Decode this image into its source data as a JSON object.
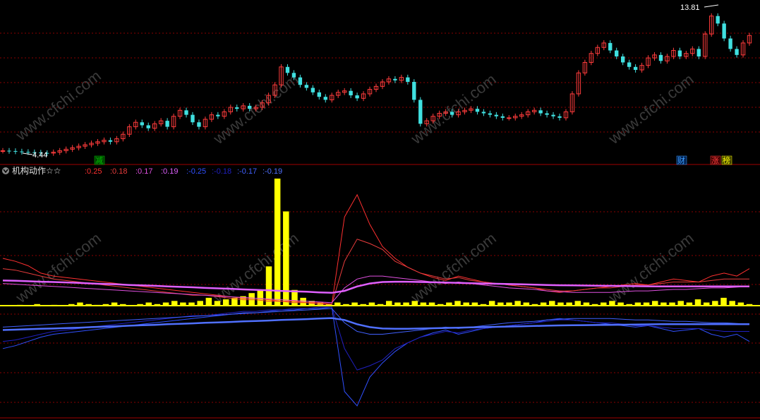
{
  "indicator": {
    "name": "机构动作☆☆",
    "values": [
      {
        "text": ":0.25",
        "color": "#ff3030"
      },
      {
        "text": ":0.18",
        "color": "#e83c3c"
      },
      {
        "text": ":0.17",
        "color": "#e050e0"
      },
      {
        "text": ":0.19",
        "color": "#e060ff"
      },
      {
        "text": ":-0.25",
        "color": "#3050ff"
      },
      {
        "text": ":-0.18",
        "color": "#2020c0"
      },
      {
        "text": ":-0.17",
        "color": "#4060ff"
      },
      {
        "text": ":-0.19",
        "color": "#5070ff"
      }
    ]
  },
  "price": {
    "high_label": "13.81",
    "low_label": "4.44",
    "markers": [
      {
        "text": "减",
        "color": "#00c000",
        "bg": "#004000"
      },
      {
        "text": "财",
        "color": "#40a0ff",
        "bg": "#002050"
      },
      {
        "text": "涨",
        "color": "#ff4040",
        "bg": "#400000"
      },
      {
        "text": "榜",
        "color": "#ffff00",
        "bg": "#404000"
      }
    ]
  },
  "watermark": "www.cfchi.com",
  "colors": {
    "up": "#ff3c3c",
    "down": "#40e0e0",
    "yellow": "#ffff00",
    "magenta": "#e050e0",
    "blue": "#3040ff",
    "grid": "#8a0000"
  },
  "chart_data": [
    {
      "type": "candlestick",
      "description_axis": "price",
      "ylim": [
        4.2,
        14.2
      ],
      "close": [
        4.6,
        4.58,
        4.55,
        4.52,
        4.5,
        4.48,
        4.45,
        4.44,
        4.5,
        4.6,
        4.7,
        4.8,
        4.9,
        5.0,
        5.1,
        5.2,
        5.3,
        5.2,
        5.4,
        5.7,
        6.2,
        6.5,
        6.3,
        6.1,
        6.4,
        6.6,
        6.2,
        6.9,
        7.3,
        7.0,
        6.5,
        6.2,
        6.7,
        7.0,
        6.9,
        7.2,
        7.5,
        7.4,
        7.6,
        7.4,
        7.5,
        7.8,
        8.3,
        9.0,
        10.2,
        9.8,
        9.5,
        9.0,
        8.8,
        8.5,
        8.2,
        8.0,
        8.3,
        8.5,
        8.6,
        8.3,
        8.1,
        8.4,
        8.7,
        8.9,
        9.2,
        9.4,
        9.3,
        9.5,
        9.2,
        8.0,
        6.4,
        6.6,
        6.9,
        7.1,
        7.2,
        7.0,
        7.2,
        7.3,
        7.4,
        7.2,
        7.1,
        7.0,
        6.9,
        6.8,
        6.8,
        6.9,
        7.0,
        7.2,
        7.3,
        7.1,
        7.0,
        6.9,
        6.8,
        7.2,
        8.4,
        9.8,
        10.5,
        11.1,
        11.5,
        11.8,
        11.3,
        10.9,
        10.5,
        10.2,
        10.0,
        10.3,
        10.8,
        11.0,
        10.6,
        10.9,
        11.3,
        10.9,
        11.1,
        11.4,
        10.9,
        12.4,
        13.6,
        13.1,
        12.1,
        11.4,
        11.0,
        11.8,
        12.3
      ],
      "last_price": 13.81,
      "low_price": 4.44
    },
    {
      "type": "line",
      "description_axis": "indicator",
      "ylim": [
        -0.75,
        0.85
      ],
      "series": [
        {
          "color": "#ff3030",
          "values": [
            0.32,
            0.3,
            0.27,
            0.22,
            0.2,
            0.19,
            0.18,
            0.17,
            0.16,
            0.15,
            0.14,
            0.13,
            0.12,
            0.11,
            0.1,
            0.09,
            0.08,
            0.07,
            0.06,
            0.05,
            0.05,
            0.04,
            0.03,
            0.03,
            0.02,
            0.02,
            0.01,
            0.6,
            0.75,
            0.55,
            0.4,
            0.32,
            0.26,
            0.22,
            0.19,
            0.17,
            0.2,
            0.18,
            0.16,
            0.15,
            0.14,
            0.13,
            0.12,
            0.1,
            0.09,
            0.1,
            0.11,
            0.12,
            0.13,
            0.14,
            0.15,
            0.14,
            0.16,
            0.18,
            0.17,
            0.16,
            0.2,
            0.22,
            0.2,
            0.25
          ]
        },
        {
          "color": "#e83c3c",
          "values": [
            0.25,
            0.24,
            0.22,
            0.2,
            0.18,
            0.17,
            0.16,
            0.15,
            0.14,
            0.13,
            0.12,
            0.11,
            0.1,
            0.09,
            0.08,
            0.07,
            0.07,
            0.06,
            0.05,
            0.04,
            0.04,
            0.03,
            0.03,
            0.02,
            0.02,
            0.01,
            0.01,
            0.3,
            0.45,
            0.42,
            0.38,
            0.3,
            0.26,
            0.22,
            0.2,
            0.18,
            0.19,
            0.17,
            0.16,
            0.15,
            0.14,
            0.13,
            0.12,
            0.11,
            0.1,
            0.1,
            0.11,
            0.12,
            0.12,
            0.13,
            0.14,
            0.14,
            0.15,
            0.16,
            0.16,
            0.16,
            0.17,
            0.18,
            0.18,
            0.18
          ]
        },
        {
          "color": "#e050e0",
          "values": [
            0.15,
            0.145,
            0.14,
            0.135,
            0.13,
            0.125,
            0.12,
            0.115,
            0.11,
            0.105,
            0.1,
            0.095,
            0.09,
            0.085,
            0.08,
            0.075,
            0.07,
            0.065,
            0.06,
            0.055,
            0.05,
            0.045,
            0.04,
            0.035,
            0.03,
            0.025,
            0.02,
            0.12,
            0.18,
            0.2,
            0.2,
            0.19,
            0.18,
            0.17,
            0.16,
            0.15,
            0.16,
            0.15,
            0.14,
            0.13,
            0.12,
            0.115,
            0.11,
            0.1,
            0.095,
            0.09,
            0.09,
            0.09,
            0.09,
            0.095,
            0.1,
            0.1,
            0.105,
            0.11,
            0.11,
            0.115,
            0.12,
            0.12,
            0.125,
            0.13
          ]
        },
        {
          "color": "#e060ff",
          "values": [
            0.17,
            0.168,
            0.165,
            0.162,
            0.16,
            0.157,
            0.154,
            0.15,
            0.147,
            0.144,
            0.14,
            0.137,
            0.134,
            0.13,
            0.127,
            0.124,
            0.12,
            0.117,
            0.114,
            0.11,
            0.107,
            0.104,
            0.1,
            0.097,
            0.094,
            0.09,
            0.087,
            0.1,
            0.13,
            0.15,
            0.16,
            0.162,
            0.162,
            0.16,
            0.158,
            0.156,
            0.154,
            0.152,
            0.15,
            0.148,
            0.146,
            0.144,
            0.142,
            0.14,
            0.138,
            0.137,
            0.136,
            0.135,
            0.134,
            0.133,
            0.132,
            0.131,
            0.13,
            0.13,
            0.13,
            0.13,
            0.13,
            0.13,
            0.13,
            0.13
          ]
        },
        {
          "color": "#3050ff",
          "values": [
            -0.3,
            -0.28,
            -0.25,
            -0.22,
            -0.2,
            -0.19,
            -0.18,
            -0.17,
            -0.16,
            -0.15,
            -0.14,
            -0.13,
            -0.12,
            -0.11,
            -0.1,
            -0.09,
            -0.08,
            -0.07,
            -0.06,
            -0.05,
            -0.05,
            -0.04,
            -0.03,
            -0.03,
            -0.02,
            -0.02,
            -0.01,
            -0.6,
            -0.7,
            -0.5,
            -0.4,
            -0.32,
            -0.26,
            -0.22,
            -0.19,
            -0.17,
            -0.2,
            -0.18,
            -0.16,
            -0.15,
            -0.14,
            -0.13,
            -0.12,
            -0.1,
            -0.09,
            -0.1,
            -0.11,
            -0.12,
            -0.13,
            -0.14,
            -0.15,
            -0.14,
            -0.16,
            -0.18,
            -0.17,
            -0.16,
            -0.2,
            -0.22,
            -0.2,
            -0.25
          ]
        },
        {
          "color": "#2020c0",
          "values": [
            -0.25,
            -0.24,
            -0.22,
            -0.2,
            -0.18,
            -0.17,
            -0.16,
            -0.15,
            -0.14,
            -0.13,
            -0.12,
            -0.11,
            -0.1,
            -0.09,
            -0.08,
            -0.07,
            -0.07,
            -0.06,
            -0.05,
            -0.04,
            -0.04,
            -0.03,
            -0.03,
            -0.02,
            -0.02,
            -0.01,
            -0.01,
            -0.3,
            -0.45,
            -0.42,
            -0.38,
            -0.3,
            -0.26,
            -0.22,
            -0.2,
            -0.18,
            -0.19,
            -0.17,
            -0.16,
            -0.15,
            -0.14,
            -0.13,
            -0.12,
            -0.11,
            -0.1,
            -0.1,
            -0.11,
            -0.12,
            -0.12,
            -0.13,
            -0.14,
            -0.14,
            -0.15,
            -0.16,
            -0.16,
            -0.16,
            -0.17,
            -0.18,
            -0.18,
            -0.18
          ]
        },
        {
          "color": "#4060ff",
          "values": [
            -0.15,
            -0.145,
            -0.14,
            -0.135,
            -0.13,
            -0.125,
            -0.12,
            -0.115,
            -0.11,
            -0.105,
            -0.1,
            -0.095,
            -0.09,
            -0.085,
            -0.08,
            -0.075,
            -0.07,
            -0.065,
            -0.06,
            -0.055,
            -0.05,
            -0.045,
            -0.04,
            -0.035,
            -0.03,
            -0.025,
            -0.02,
            -0.12,
            -0.18,
            -0.2,
            -0.2,
            -0.19,
            -0.18,
            -0.17,
            -0.16,
            -0.15,
            -0.16,
            -0.15,
            -0.14,
            -0.13,
            -0.12,
            -0.115,
            -0.11,
            -0.1,
            -0.095,
            -0.09,
            -0.09,
            -0.09,
            -0.09,
            -0.095,
            -0.1,
            -0.1,
            -0.105,
            -0.11,
            -0.11,
            -0.115,
            -0.12,
            -0.12,
            -0.125,
            -0.13
          ]
        },
        {
          "color": "#5070ff",
          "values": [
            -0.17,
            -0.168,
            -0.165,
            -0.162,
            -0.16,
            -0.157,
            -0.154,
            -0.15,
            -0.147,
            -0.144,
            -0.14,
            -0.137,
            -0.134,
            -0.13,
            -0.127,
            -0.124,
            -0.12,
            -0.117,
            -0.114,
            -0.11,
            -0.107,
            -0.104,
            -0.1,
            -0.097,
            -0.094,
            -0.09,
            -0.087,
            -0.1,
            -0.13,
            -0.15,
            -0.16,
            -0.162,
            -0.162,
            -0.16,
            -0.158,
            -0.156,
            -0.154,
            -0.152,
            -0.15,
            -0.148,
            -0.146,
            -0.144,
            -0.142,
            -0.14,
            -0.138,
            -0.137,
            -0.136,
            -0.135,
            -0.134,
            -0.133,
            -0.132,
            -0.131,
            -0.13,
            -0.13,
            -0.13,
            -0.13,
            -0.13,
            -0.13,
            -0.13,
            -0.13
          ]
        }
      ]
    },
    {
      "type": "bar",
      "description_axis": "indicator",
      "ylim": [
        0,
        0.8
      ],
      "color": "#ffff00",
      "values": [
        0.0,
        0.0,
        0.005,
        0.0,
        0.01,
        0.0,
        0.005,
        0.0,
        0.01,
        0.02,
        0.01,
        0.005,
        0.01,
        0.02,
        0.01,
        0.0,
        0.01,
        0.02,
        0.01,
        0.02,
        0.03,
        0.02,
        0.02,
        0.03,
        0.05,
        0.03,
        0.04,
        0.05,
        0.06,
        0.08,
        0.1,
        0.25,
        0.82,
        0.6,
        0.1,
        0.05,
        0.03,
        0.02,
        0.01,
        0.02,
        0.01,
        0.02,
        0.01,
        0.02,
        0.01,
        0.03,
        0.02,
        0.02,
        0.03,
        0.02,
        0.02,
        0.01,
        0.02,
        0.03,
        0.02,
        0.02,
        0.01,
        0.03,
        0.02,
        0.02,
        0.03,
        0.02,
        0.01,
        0.02,
        0.03,
        0.02,
        0.02,
        0.03,
        0.02,
        0.01,
        0.02,
        0.03,
        0.02,
        0.01,
        0.02,
        0.02,
        0.03,
        0.02,
        0.02,
        0.03,
        0.02,
        0.04,
        0.02,
        0.03,
        0.05,
        0.03,
        0.02,
        0.01
      ]
    }
  ]
}
